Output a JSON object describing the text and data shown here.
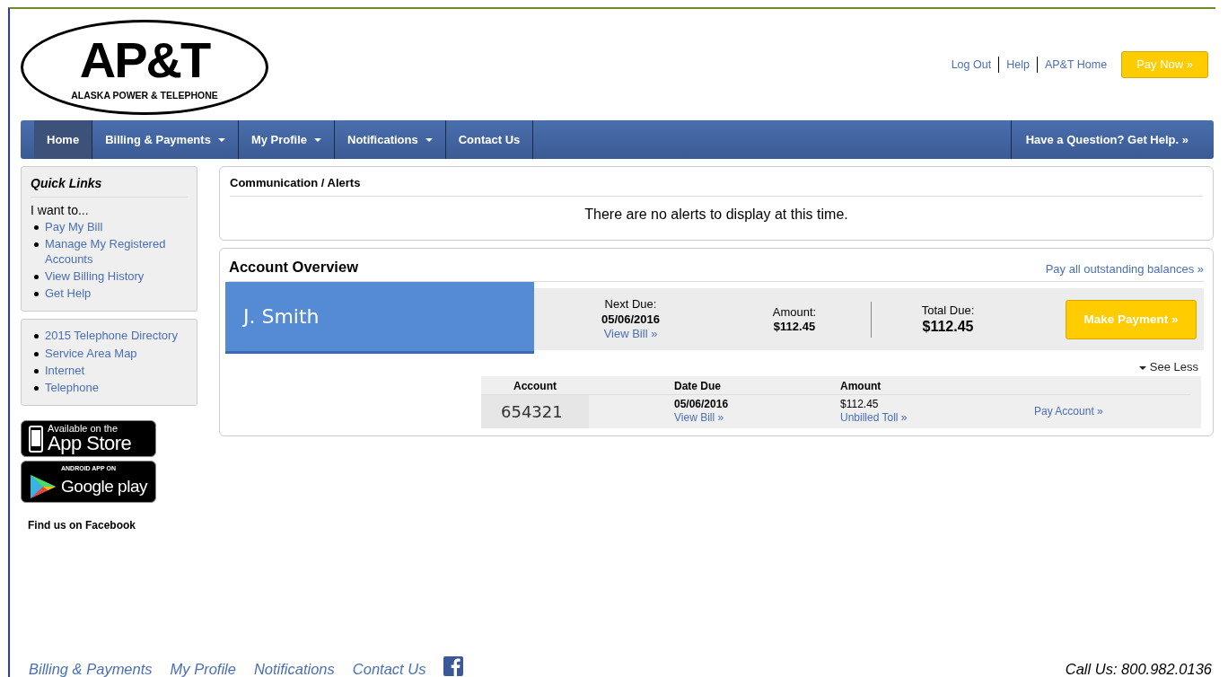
{
  "logo": {
    "mark": "AP&T",
    "name": "ALASKA POWER & TELEPHONE"
  },
  "top_links": [
    "Log Out",
    "Help",
    "AP&T Home"
  ],
  "pay_now": "Pay Now »",
  "nav": [
    {
      "label": "Home",
      "selected": true,
      "dropdown": false
    },
    {
      "label": "Billing & Payments",
      "selected": false,
      "dropdown": true
    },
    {
      "label": "My Profile",
      "selected": false,
      "dropdown": true
    },
    {
      "label": "Notifications",
      "selected": false,
      "dropdown": true
    },
    {
      "label": "Contact Us",
      "selected": false,
      "dropdown": false
    }
  ],
  "nav_help": "Have a Question? Get Help. »",
  "quick_links": {
    "title": "Quick Links",
    "intro": "I want to...",
    "items": [
      "Pay My Bill",
      "Manage My Registered Accounts",
      "View Billing History",
      "Get Help"
    ]
  },
  "more_links": [
    "2015 Telephone Directory",
    "Service Area Map",
    "Internet",
    "Telephone"
  ],
  "app_store": {
    "small": "Available on the",
    "big": "App Store"
  },
  "google_play": {
    "small": "ANDROID APP ON",
    "big": "Google play"
  },
  "facebook_label": "Find us on Facebook",
  "alerts": {
    "title": "Communication / Alerts",
    "message": "There are no alerts to display at this time."
  },
  "overview": {
    "title": "Account Overview",
    "pay_all": "Pay all outstanding balances »",
    "customer": "J. Smith",
    "next_due_label": "Next Due:",
    "next_due": "05/06/2016",
    "view_bill": "View Bill »",
    "amount_label": "Amount:",
    "amount": "$112.45",
    "total_label": "Total Due:",
    "total": "$112.45",
    "make_payment": "Make Payment »",
    "see_less": "See Less",
    "columns": [
      "Account",
      "Date Due",
      "Amount"
    ],
    "rows": [
      {
        "account": "654321",
        "date_due": "05/06/2016",
        "view_bill": "View Bill »",
        "amount": "$112.45",
        "unbilled": "Unbilled Toll »",
        "pay": "Pay Account »"
      }
    ]
  },
  "footer_links": [
    "Billing & Payments",
    "My Profile",
    "Notifications",
    "Contact Us"
  ],
  "call_us": "Call Us: 800.982.0136"
}
